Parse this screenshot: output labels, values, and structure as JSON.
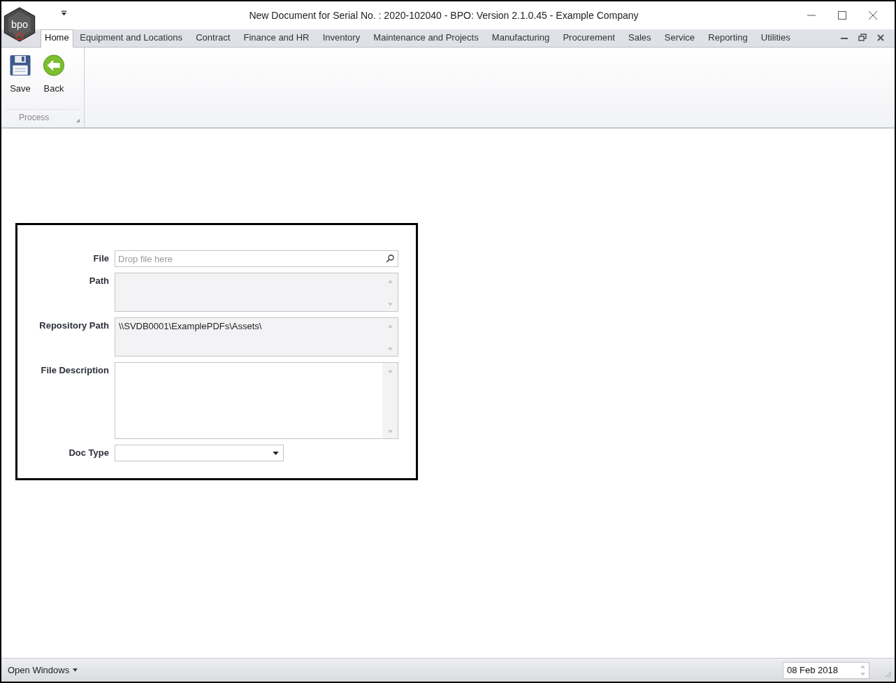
{
  "window": {
    "title": "New Document for Serial No. : 2020-102040 - BPO: Version 2.1.0.45 - Example Company",
    "logo_text": "bpo"
  },
  "tabs": [
    {
      "label": "Home",
      "selected": true
    },
    {
      "label": "Equipment and Locations",
      "selected": false
    },
    {
      "label": "Contract",
      "selected": false
    },
    {
      "label": "Finance and HR",
      "selected": false
    },
    {
      "label": "Inventory",
      "selected": false
    },
    {
      "label": "Maintenance and Projects",
      "selected": false
    },
    {
      "label": "Manufacturing",
      "selected": false
    },
    {
      "label": "Procurement",
      "selected": false
    },
    {
      "label": "Sales",
      "selected": false
    },
    {
      "label": "Service",
      "selected": false
    },
    {
      "label": "Reporting",
      "selected": false
    },
    {
      "label": "Utilities",
      "selected": false
    }
  ],
  "ribbon": {
    "groups": [
      {
        "label": "Process",
        "buttons": [
          {
            "label": "Save",
            "kind": "save"
          },
          {
            "label": "Back",
            "kind": "back"
          }
        ]
      }
    ]
  },
  "form": {
    "fields": [
      {
        "label": "File",
        "kind": "search",
        "placeholder": "Drop file here",
        "disabled": false
      },
      {
        "label": "Path",
        "kind": "memo",
        "disabled": true
      },
      {
        "label": "Repository Path",
        "kind": "memo",
        "value": "\\\\SVDB0001\\ExamplePDFs\\Assets\\",
        "disabled": true
      },
      {
        "label": "File Description",
        "kind": "memo-tall",
        "disabled": false
      },
      {
        "label": "Doc Type",
        "kind": "dropdown",
        "disabled": false
      }
    ]
  },
  "status_bar": {
    "open_windows": "Open Windows",
    "date": "08 Feb 2018"
  }
}
